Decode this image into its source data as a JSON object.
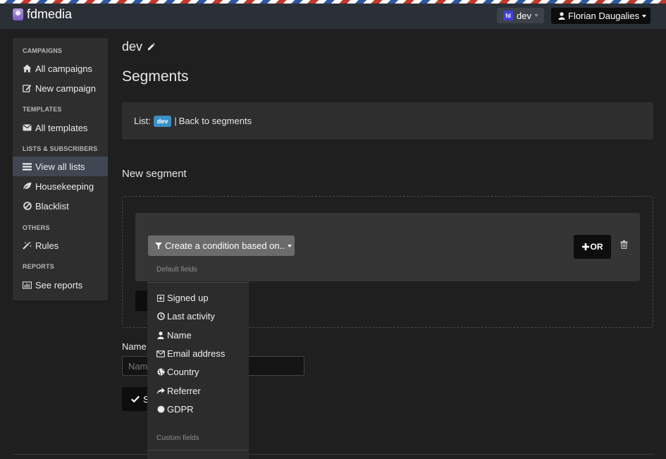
{
  "brand": {
    "name": "fdmedia",
    "logo_icon": "fdmedia-logo-icon"
  },
  "topbar": {
    "list_badge": "fd",
    "list_name": "dev",
    "user_name": "Florian Daugalies"
  },
  "sidebar": {
    "sections": [
      {
        "heading": "CAMPAIGNS",
        "items": [
          {
            "label": "All campaigns",
            "icon": "home-icon"
          },
          {
            "label": "New campaign",
            "icon": "edit-icon"
          }
        ]
      },
      {
        "heading": "TEMPLATES",
        "items": [
          {
            "label": "All templates",
            "icon": "envelope-icon"
          }
        ]
      },
      {
        "heading": "LISTS & SUBSCRIBERS",
        "items": [
          {
            "label": "View all lists",
            "icon": "list-icon",
            "active": true
          },
          {
            "label": "Housekeeping",
            "icon": "leaf-icon"
          },
          {
            "label": "Blacklist",
            "icon": "ban-icon"
          }
        ]
      },
      {
        "heading": "OTHERS",
        "items": [
          {
            "label": "Rules",
            "icon": "magic-wand-icon"
          }
        ]
      },
      {
        "heading": "REPORTS",
        "items": [
          {
            "label": "See reports",
            "icon": "bar-chart-icon"
          }
        ]
      }
    ]
  },
  "main": {
    "list_title": "dev",
    "page_title": "Segments",
    "breadcrumb": {
      "prefix": "List:",
      "tag": "dev",
      "separator": "|",
      "back_link": "Back to segments"
    },
    "new_segment_heading": "New segment",
    "create_condition_label": "Create a condition based on..",
    "or_button_label": "OR",
    "name_label": "Name",
    "name_placeholder": "Name",
    "save_label": "S"
  },
  "dropdown": {
    "default_heading": "Default fields",
    "items": [
      {
        "label": "Signed up",
        "icon": "plus-square-icon"
      },
      {
        "label": "Last activity",
        "icon": "clock-icon"
      },
      {
        "label": "Name",
        "icon": "user-icon"
      },
      {
        "label": "Email address",
        "icon": "envelope-icon"
      },
      {
        "label": "Country",
        "icon": "globe-icon"
      },
      {
        "label": "Referrer",
        "icon": "share-icon"
      },
      {
        "label": "GDPR",
        "icon": "certificate-icon"
      }
    ],
    "custom_heading": "Custom fields"
  },
  "colors": {
    "navbar": "#2b2f36",
    "background": "#1f1f1f",
    "panel": "#2e2e2e",
    "active_item": "#404652",
    "tag_blue": "#3a8fc7"
  }
}
